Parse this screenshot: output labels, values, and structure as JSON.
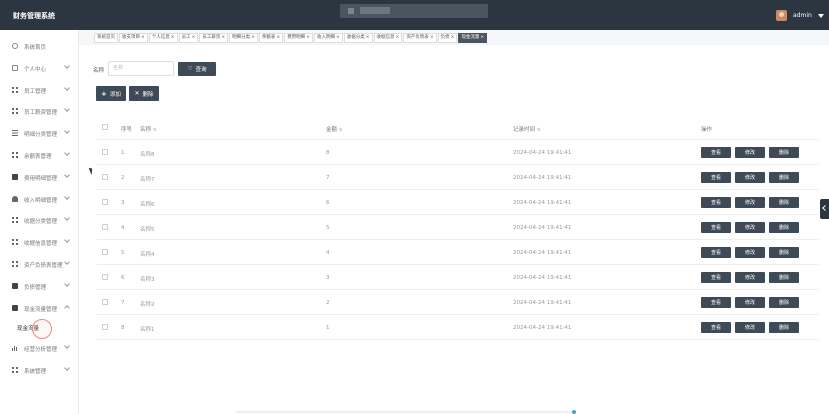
{
  "header": {
    "app_title": "财务管理系统",
    "user_name": "admin"
  },
  "sidebar": {
    "items": [
      {
        "label": "系统首页",
        "icon": "home-icon"
      },
      {
        "label": "个人中心",
        "icon": "calendar-icon"
      },
      {
        "label": "员工管理",
        "icon": "grid-icon"
      },
      {
        "label": "员工薪资管理",
        "icon": "grid-icon"
      },
      {
        "label": "明细分类管理",
        "icon": "list-icon"
      },
      {
        "label": "余额表管理",
        "icon": "grid-icon"
      },
      {
        "label": "费用明细管理",
        "icon": "doc-icon"
      },
      {
        "label": "收入明细管理",
        "icon": "user-icon"
      },
      {
        "label": "收据分类管理",
        "icon": "grid-icon"
      },
      {
        "label": "收据信息管理",
        "icon": "grid-icon"
      },
      {
        "label": "资产负债表管理",
        "icon": "grid-icon"
      },
      {
        "label": "负债管理",
        "icon": "lock-icon"
      },
      {
        "label": "现金流量管理",
        "icon": "doc-icon"
      }
    ],
    "sub_item": "现金流量",
    "items_after": [
      {
        "label": "经营分析管理",
        "icon": "chart-icon"
      },
      {
        "label": "系统管理",
        "icon": "grid-icon"
      }
    ]
  },
  "tabs": [
    {
      "label": "系统首页",
      "closable": false
    },
    {
      "label": "收支项目",
      "closable": true
    },
    {
      "label": "个人信息",
      "closable": true
    },
    {
      "label": "员工",
      "closable": true
    },
    {
      "label": "员工薪资",
      "closable": true
    },
    {
      "label": "明细分类",
      "closable": true
    },
    {
      "label": "余额表",
      "closable": true
    },
    {
      "label": "费用明细",
      "closable": true
    },
    {
      "label": "收入明细",
      "closable": true
    },
    {
      "label": "收据分类",
      "closable": true
    },
    {
      "label": "收据信息",
      "closable": true
    },
    {
      "label": "资产负债表",
      "closable": true
    },
    {
      "label": "负债",
      "closable": true
    },
    {
      "label": "现金流量",
      "closable": true,
      "active": true
    }
  ],
  "search": {
    "label": "名称",
    "placeholder": "名称",
    "button": "查询"
  },
  "actions": {
    "add": "添加",
    "delete": "删除"
  },
  "table": {
    "headers": {
      "no": "序号",
      "name": "名称",
      "amount": "金额",
      "time": "记录时间",
      "op": "操作"
    },
    "row_buttons": {
      "view": "查看",
      "edit": "修改",
      "del": "删除"
    },
    "rows": [
      {
        "no": "1",
        "name": "名称8",
        "amount": "8",
        "time": "2024-04-24 19:41:41"
      },
      {
        "no": "2",
        "name": "名称7",
        "amount": "7",
        "time": "2024-04-24 19:41:41"
      },
      {
        "no": "3",
        "name": "名称6",
        "amount": "6",
        "time": "2024-04-24 19:41:41"
      },
      {
        "no": "4",
        "name": "名称5",
        "amount": "5",
        "time": "2024-04-24 19:41:41"
      },
      {
        "no": "5",
        "name": "名称4",
        "amount": "4",
        "time": "2024-04-24 19:41:41"
      },
      {
        "no": "6",
        "name": "名称3",
        "amount": "3",
        "time": "2024-04-24 19:41:41"
      },
      {
        "no": "7",
        "name": "名称2",
        "amount": "2",
        "time": "2024-04-24 19:41:41"
      },
      {
        "no": "8",
        "name": "名称1",
        "amount": "1",
        "time": "2024-04-24 19:41:41"
      }
    ]
  }
}
